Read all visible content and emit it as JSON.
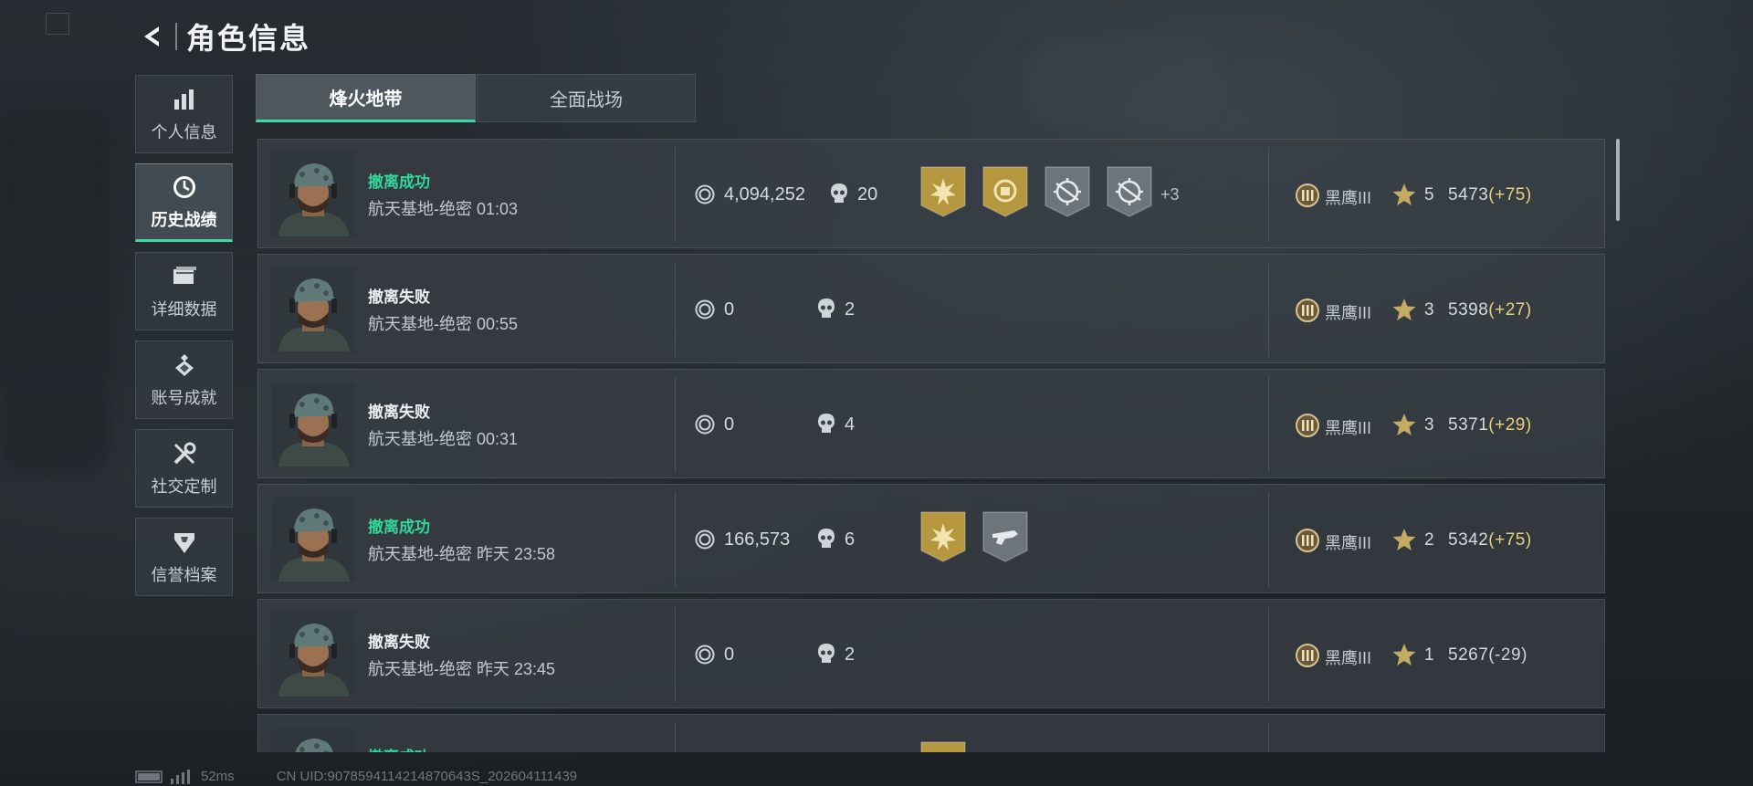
{
  "header": {
    "title": "角色信息"
  },
  "sidebar": {
    "items": [
      {
        "label": "个人信息",
        "icon": "bar-chart-icon"
      },
      {
        "label": "历史战绩",
        "icon": "clock-icon",
        "active": true
      },
      {
        "label": "详细数据",
        "icon": "folder-icon"
      },
      {
        "label": "账号成就",
        "icon": "achievement-icon"
      },
      {
        "label": "社交定制",
        "icon": "tools-icon"
      },
      {
        "label": "信誉档案",
        "icon": "shield-icon"
      }
    ]
  },
  "tabs": [
    {
      "label": "烽火地带",
      "active": true
    },
    {
      "label": "全面战场"
    }
  ],
  "matches": [
    {
      "status": "撤离成功",
      "map": "航天基地-绝密 01:03",
      "value": "4,094,252",
      "kills": "20",
      "medals": [
        "gold-burst-medal",
        "gold-emblem-medal",
        "silver-crosshair-medal",
        "silver-crosshair-medal"
      ],
      "more_medals": "+3",
      "rank": "黑鹰III",
      "stars": "5",
      "score": "5473",
      "delta": "(+75)"
    },
    {
      "status": "撤离失败",
      "map": "航天基地-绝密 00:55",
      "value": "0",
      "kills": "2",
      "medals": [],
      "rank": "黑鹰III",
      "stars": "3",
      "score": "5398",
      "delta": "(+27)"
    },
    {
      "status": "撤离失败",
      "map": "航天基地-绝密 00:31",
      "value": "0",
      "kills": "4",
      "medals": [],
      "rank": "黑鹰III",
      "stars": "3",
      "score": "5371",
      "delta": "(+29)"
    },
    {
      "status": "撤离成功",
      "map": "航天基地-绝密 昨天 23:58",
      "value": "166,573",
      "kills": "6",
      "medals": [
        "gold-burst-medal",
        "silver-gun-medal"
      ],
      "rank": "黑鹰III",
      "stars": "2",
      "score": "5342",
      "delta": "(+75)"
    },
    {
      "status": "撤离失败",
      "map": "航天基地-绝密 昨天 23:45",
      "value": "0",
      "kills": "2",
      "medals": [],
      "rank": "黑鹰III",
      "stars": "1",
      "score": "5267",
      "delta": "(-29)"
    },
    {
      "status": "撤离成功",
      "map": "",
      "value": "",
      "kills": "",
      "medals": [
        "gold-burst-medal"
      ],
      "rank": "",
      "stars": "",
      "score": "",
      "delta": ""
    }
  ],
  "footer": {
    "ping": "52ms",
    "uid": "CN UID:9078594114214870643S_202604111439"
  },
  "colors": {
    "accent": "#3fd9a4",
    "success": "#33d69b",
    "score_up": "#e7d17c",
    "medal_gold": "#b79a45",
    "medal_silver": "#6d757b"
  }
}
